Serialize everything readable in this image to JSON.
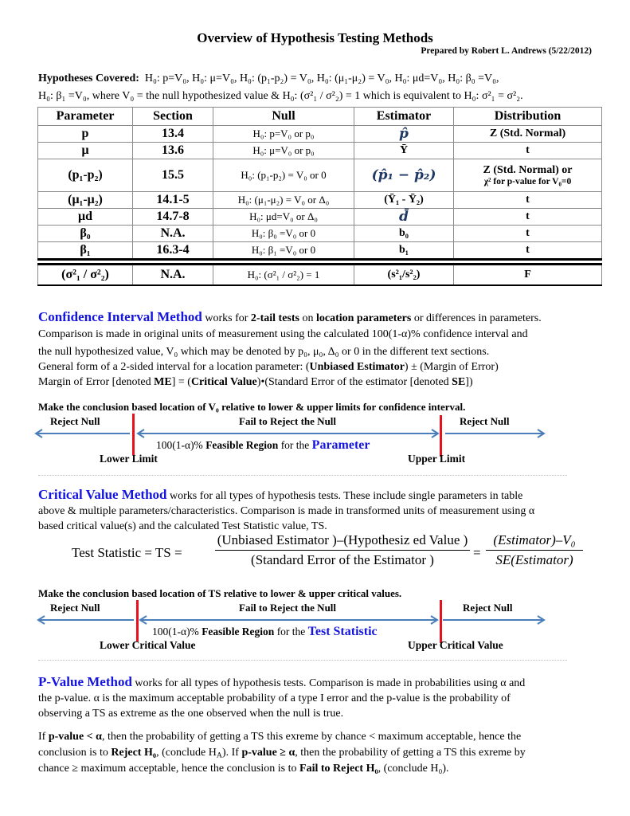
{
  "document": {
    "title": "Overview of Hypothesis Testing Methods",
    "prepared_by": "Prepared by Robert L. Andrews (5/22/2012)"
  },
  "hypotheses": {
    "label": "Hypotheses Covered:",
    "line1": "H₀: p=V₀, H₀: μ=V₀, H₀: (p₁-p₂) = V₀, H₀: (μ₁-μ₂) = V₀, H₀: μd=V₀, H₀: β₀ =V₀,",
    "line2": "H₀: β₁ =V₀, where V₀ = the null hypothesized value & H₀: (σ²₁ / σ²₂) = 1 which is equivalent to H₀: σ²₁ = σ²₂."
  },
  "table": {
    "headers": [
      "Parameter",
      "Section",
      "Null",
      "Estimator",
      "Distribution"
    ],
    "rows": [
      {
        "parameter": "p",
        "section": "13.4",
        "null": "H₀: p=V₀ or p₀",
        "estimator": "p̂",
        "distribution": "Z (Std. Normal)"
      },
      {
        "parameter": "μ",
        "section": "13.6",
        "null": "H₀: μ=V₀ or p₀",
        "estimator": "Ȳ",
        "distribution": "t"
      },
      {
        "parameter": "(p₁-p₂)",
        "section": "15.5",
        "null": "H₀: (p₁-p₂) = V₀ or 0",
        "estimator": "(p̂₁ − p̂₂)",
        "distribution": "Z (Std. Normal) or",
        "distribution_line2": "χ² for p-value for V₀=0"
      },
      {
        "parameter": "(μ₁-μ₂)",
        "section": "14.1-5",
        "null": "H₀: (μ₁-μ₂) = V₀ or Δ₀",
        "estimator": "(Ȳ₁ - Ȳ₂)",
        "distribution": "t"
      },
      {
        "parameter": "μd",
        "section": "14.7-8",
        "null": "H₀: μd=V₀ or Δ₀",
        "estimator": "d̄",
        "distribution": "t"
      },
      {
        "parameter": "β₀",
        "section": "N.A.",
        "null": "H₀: β₀ =V₀ or 0",
        "estimator": "b₀",
        "distribution": "t"
      },
      {
        "parameter": "β₁",
        "section": "16.3-4",
        "null": "H₀: β₁ =V₀ or 0",
        "estimator": "b₁",
        "distribution": "t"
      },
      {
        "parameter": "(σ²₁ / σ²₂)",
        "section": "N.A.",
        "null": "H₀: (σ²₁ / σ²₂) = 1",
        "estimator": "(s²₁/s²₂)",
        "distribution": "F"
      }
    ]
  },
  "ci_method": {
    "heading": "Confidence Interval Method",
    "intro_1": " works for ",
    "bold_1": "2-tail tests",
    "intro_2": " on ",
    "bold_2": "location parameters",
    "intro_3": " or differences in parameters.",
    "line2": "Comparison is made in original units of measurement using the calculated 100(1-α)% confidence interval and",
    "line3": "the null hypothesized value, V₀ which may be denoted by p₀, μ₀, Δ₀ or 0 in the different text sections.",
    "line4_pre": "General form of a 2-sided interval for a location parameter:  (",
    "line4_bold": "Unbiased Estimator",
    "line4_post": ") ± (Margin of Error)",
    "line5_pre": "Margin of Error [denoted ",
    "line5_b1": "ME",
    "line5_mid": "] = (",
    "line5_b2": "Critical Value",
    "line5_mid2": ")•(Standard Error of the estimator [denoted ",
    "line5_b3": "SE",
    "line5_post": "])",
    "conclusion": "Make the conclusion based location of V₀ relative to lower & upper limits for confidence interval.",
    "diagram": {
      "left_label": "Reject Null",
      "middle_label": "Fail to Reject the Null",
      "right_label": "Reject Null",
      "feasible_pre": "100(1-α)% ",
      "feasible_bold": "Feasible Region",
      "feasible_mid": " for the ",
      "feasible_emph": "Parameter",
      "lower": "Lower Limit",
      "upper": "Upper Limit"
    }
  },
  "cv_method": {
    "heading": "Critical Value Method",
    "line1": " works for all types of hypothesis tests.  These include single parameters in table",
    "line2": "above & multiple parameters/characteristics.  Comparison is made in transformed units of measurement using α",
    "line3": "based critical value(s) and the calculated Test Statistic value, TS.",
    "formula": {
      "lhs": "Test Statistic  = TS =",
      "num1": "(Unbiased Estimator )–(Hypothesiz ed Value )",
      "den1": "(Standard Error of the Estimator )",
      "eq": "=",
      "num2": "(Estimator)–V₀",
      "den2": "SE(Estimator)"
    },
    "conclusion": "Make the conclusion based location of TS relative to lower & upper critical values.",
    "diagram": {
      "left_label": "Reject Null",
      "middle_label": "Fail to Reject the Null",
      "right_label": "Reject Null",
      "feasible_pre": "100(1-α)% ",
      "feasible_bold": "Feasible Region",
      "feasible_mid": " for the ",
      "feasible_emph": "Test Statistic",
      "lower": "Lower Critical Value",
      "upper": "Upper Critical Value"
    }
  },
  "pv_method": {
    "heading": "P-Value Method",
    "line1": " works for all types of hypothesis tests.  Comparison is made in probabilities using α and",
    "line2": "the p-value.  α is the maximum acceptable probability of a type I error and the p-value is the probability of",
    "line3": "observing a TS as extreme as the one observed when the null is true.",
    "rule": {
      "if1": "If ",
      "cond1": "p-value < α",
      "t1": ", then the probability of getting a TS this exreme by chance < maximum acceptable, hence the",
      "t2": "conclusion is to ",
      "reject": "Reject H₀",
      "t3": ", (conclude H",
      "ha": "A",
      "t4": ").  If ",
      "cond2": "p-value ≥ α",
      "t5": ", then the probability of getting a TS this exreme by",
      "t6": "chance ≥ maximum acceptable, hence the conclusion is to ",
      "fail": "Fail to Reject H₀",
      "t7": ", (conclude H₀)."
    }
  },
  "colors": {
    "heading_blue": "#1414e0",
    "arrow_blue": "#4a7ebb",
    "limit_red": "#e8101c",
    "estimator_navy": "#1f3864"
  }
}
